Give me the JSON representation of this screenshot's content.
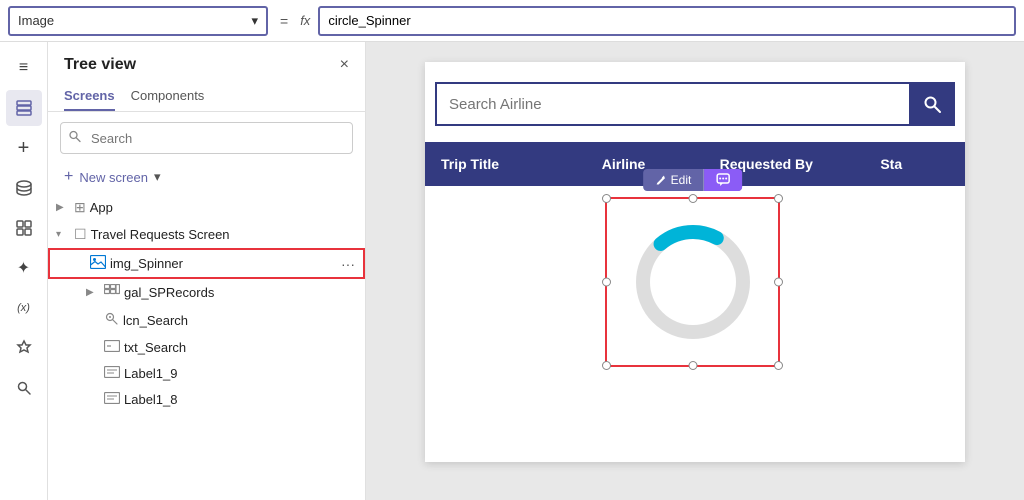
{
  "formula_bar": {
    "selector_label": "Image",
    "equals": "=",
    "fx": "fx",
    "formula_value": "circle_Spinner"
  },
  "tree_view": {
    "title": "Tree view",
    "close_icon": "×",
    "tabs": [
      {
        "label": "Screens",
        "active": true
      },
      {
        "label": "Components",
        "active": false
      }
    ],
    "search_placeholder": "Search",
    "new_screen_label": "New screen",
    "items": [
      {
        "id": "app",
        "label": "App",
        "indent": 0,
        "expandable": true,
        "icon": "🔲"
      },
      {
        "id": "travel-screen",
        "label": "Travel Requests Screen",
        "indent": 0,
        "expandable": true,
        "expanded": true,
        "icon": "▢"
      },
      {
        "id": "img-spinner",
        "label": "img_Spinner",
        "indent": 1,
        "selected": true,
        "icon": "🖼",
        "dots": "···"
      },
      {
        "id": "gal-sprecords",
        "label": "gal_SPRecords",
        "indent": 2,
        "expandable": true,
        "icon": "▦"
      },
      {
        "id": "lcn-search",
        "label": "lcn_Search",
        "indent": 2,
        "icon": "⊕"
      },
      {
        "id": "txt-search",
        "label": "txt_Search",
        "indent": 2,
        "icon": "▭"
      },
      {
        "id": "label1-9",
        "label": "Label1_9",
        "indent": 2,
        "icon": "📝"
      },
      {
        "id": "label1-8",
        "label": "Label1_8",
        "indent": 2,
        "icon": "📝"
      }
    ]
  },
  "left_nav": {
    "icons": [
      {
        "id": "hamburger",
        "symbol": "≡",
        "active": false
      },
      {
        "id": "layers",
        "symbol": "⧉",
        "active": true
      },
      {
        "id": "plus",
        "symbol": "+",
        "active": false
      },
      {
        "id": "database",
        "symbol": "🗄",
        "active": false
      },
      {
        "id": "components",
        "symbol": "⊞",
        "active": false
      },
      {
        "id": "sparkle",
        "symbol": "✦",
        "active": false
      },
      {
        "id": "variable",
        "symbol": "(x)",
        "active": false
      },
      {
        "id": "plugin",
        "symbol": "⬡",
        "active": false
      },
      {
        "id": "search-nav",
        "symbol": "🔍",
        "active": false
      }
    ]
  },
  "canvas": {
    "search_placeholder": "Search Airline",
    "table_headers": [
      "Trip Title",
      "Airline",
      "Requested By",
      "Sta"
    ],
    "edit_button": "Edit",
    "comment_button": "💬"
  }
}
